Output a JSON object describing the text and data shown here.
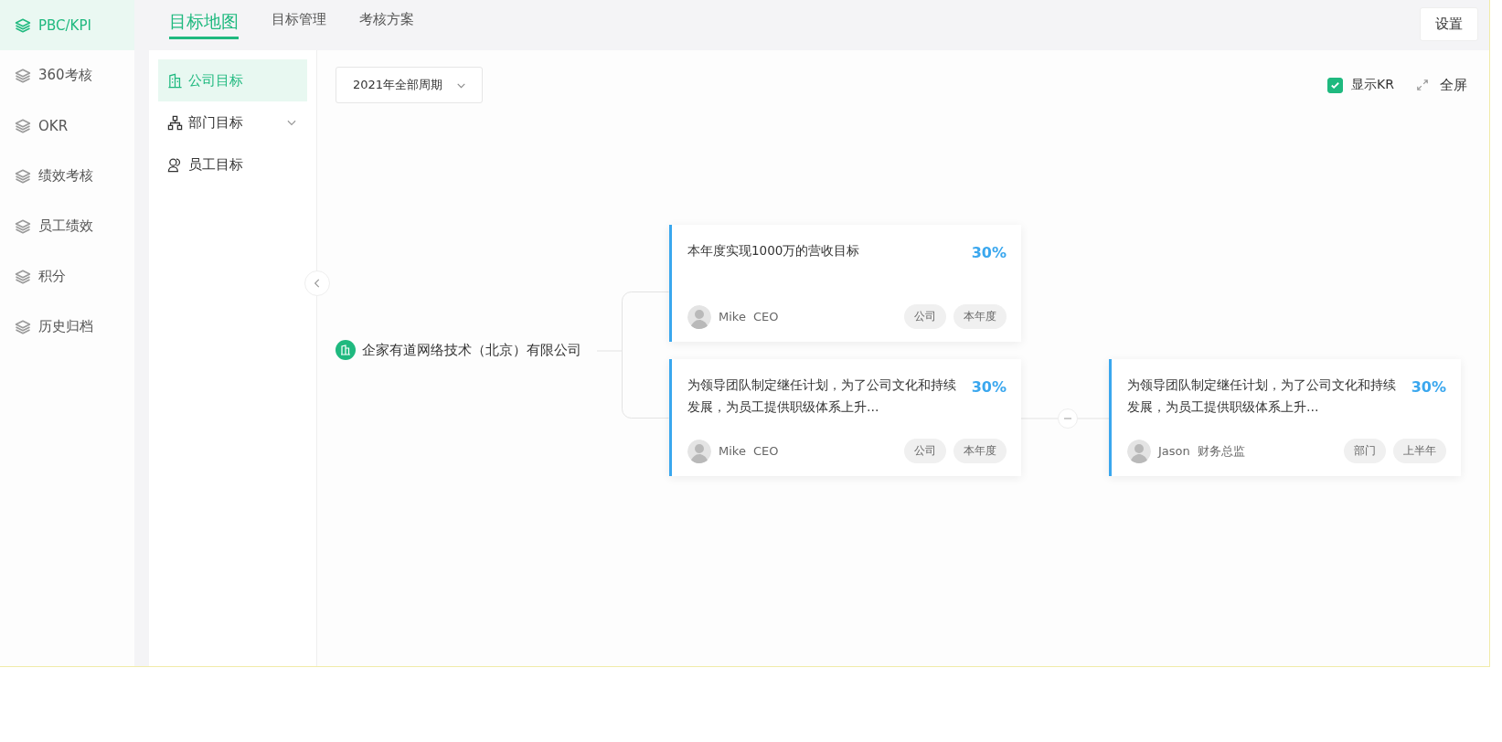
{
  "sidebar": {
    "items": [
      {
        "label": "PBC/KPI",
        "selected": true
      },
      {
        "label": "360考核",
        "selected": false
      },
      {
        "label": "OKR",
        "selected": false
      },
      {
        "label": "绩效考核",
        "selected": false
      },
      {
        "label": "员工绩效",
        "selected": false
      },
      {
        "label": "积分",
        "selected": false
      },
      {
        "label": "历史归档",
        "selected": false
      }
    ]
  },
  "tabs": [
    {
      "label": "目标地图",
      "selected": true
    },
    {
      "label": "目标管理",
      "selected": false
    },
    {
      "label": "考核方案",
      "selected": false
    }
  ],
  "settings_button": "设置",
  "subnav": {
    "items": [
      {
        "label": "公司目标",
        "selected": true,
        "kind": "building"
      },
      {
        "label": "部门目标",
        "selected": false,
        "kind": "org",
        "expanded": false
      },
      {
        "label": "员工目标",
        "selected": false,
        "kind": "user"
      }
    ]
  },
  "period_select": "2021年全部周期",
  "show_kr": {
    "label": "显示KR",
    "checked": true
  },
  "fullscreen": "全屏",
  "map": {
    "root": "企家有道网络技术（北京）有限公司",
    "goals": [
      {
        "title": "本年度实现1000万的营收目标",
        "percent": "30%",
        "owner": "Mike",
        "role": "CEO",
        "tags": [
          "公司",
          "本年度"
        ]
      },
      {
        "title": "为领导团队制定继任计划，为了公司文化和持续发展，为员工提供职级体系上升…",
        "percent": "30%",
        "owner": "Mike",
        "role": "CEO",
        "tags": [
          "公司",
          "本年度"
        ],
        "expanded": true,
        "children": [
          {
            "title": "为领导团队制定继任计划，为了公司文化和持续发展，为员工提供职级体系上升…",
            "percent": "30%",
            "owner": "Jason",
            "role": "财务总监",
            "tags": [
              "部门",
              "上半年"
            ]
          }
        ]
      }
    ]
  }
}
